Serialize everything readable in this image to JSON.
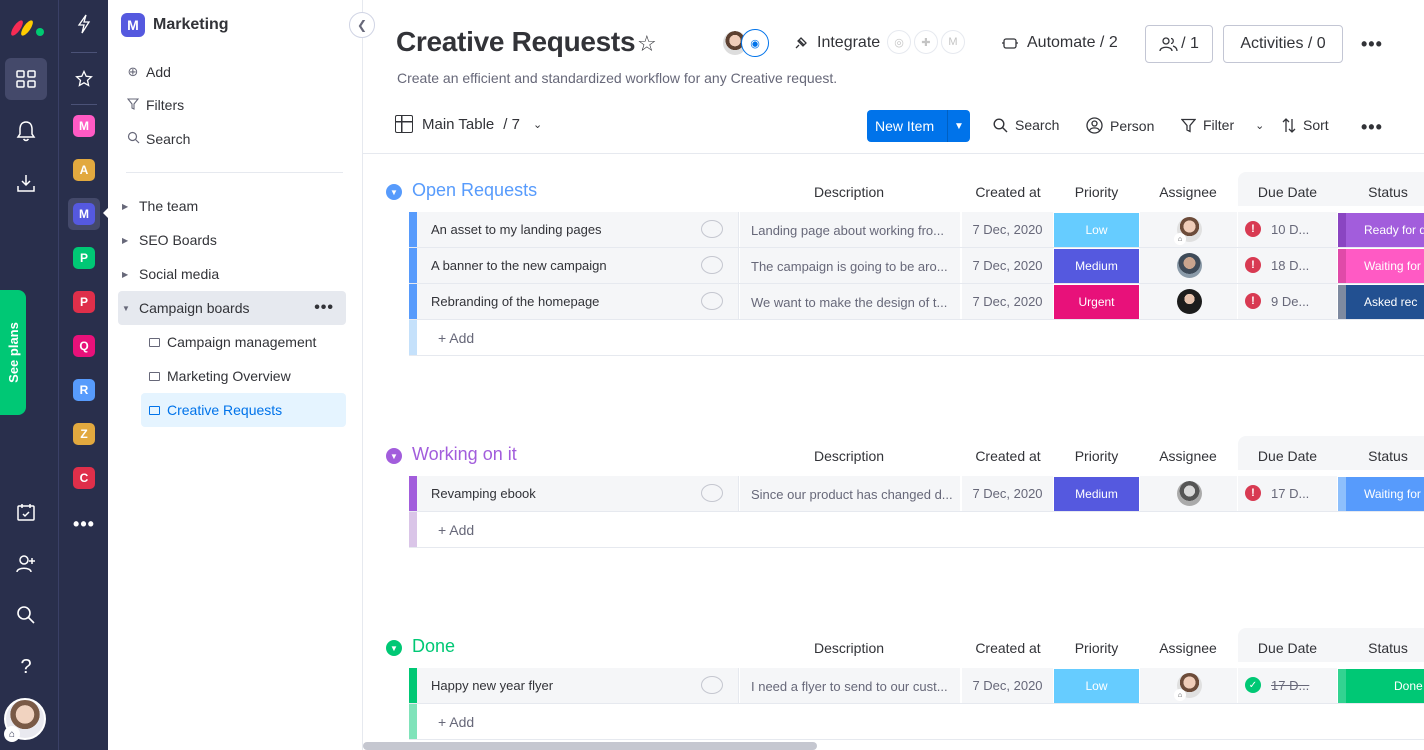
{
  "rail": {
    "see_plans": "See plans"
  },
  "workspaces": [
    {
      "letter": "M",
      "color": "#e2445c",
      "tint": "#ff7eb3"
    },
    {
      "letter": "A",
      "color": "#e2a93f"
    },
    {
      "letter": "M",
      "color": "#5559df"
    },
    {
      "letter": "P",
      "color": "#00c875"
    },
    {
      "letter": "P",
      "color": "#df2f4a"
    },
    {
      "letter": "Q",
      "color": "#e2445c"
    },
    {
      "letter": "R",
      "color": "#579bfc"
    },
    {
      "letter": "Z",
      "color": "#e2a93f"
    },
    {
      "letter": "C",
      "color": "#df2f4a"
    }
  ],
  "sidebar": {
    "workspace_letter": "M",
    "workspace_name": "Marketing",
    "actions": {
      "add": "Add",
      "filters": "Filters",
      "search": "Search"
    },
    "folders": [
      {
        "label": "The team"
      },
      {
        "label": "SEO Boards"
      },
      {
        "label": "Social media"
      },
      {
        "label": "Campaign boards"
      }
    ],
    "boards": [
      {
        "label": "Campaign management"
      },
      {
        "label": "Marketing Overview"
      },
      {
        "label": "Creative Requests"
      }
    ]
  },
  "header": {
    "title": "Creative Requests",
    "description": "Create an efficient and standardized workflow for any Creative request.",
    "integrate": "Integrate",
    "automate": "Automate / 2",
    "members": "/ 1",
    "activities": "Activities / 0"
  },
  "toolbar": {
    "view": "Main Table",
    "view_count": "/ 7",
    "new_item": "New Item",
    "search": "Search",
    "person": "Person",
    "filter": "Filter",
    "sort": "Sort"
  },
  "columns": {
    "description": "Description",
    "created": "Created at",
    "priority": "Priority",
    "assignee": "Assignee",
    "due": "Due Date",
    "status": "Status"
  },
  "colors": {
    "open": "#579bfc",
    "working": "#a25ddc",
    "done": "#00c875",
    "low": "#66ccff",
    "medium": "#5559df",
    "urgent": "#e8117a"
  },
  "groups": [
    {
      "title": "Open Requests",
      "add": "+ Add",
      "rows": [
        {
          "name": "An asset to my landing pages",
          "desc": "Landing page about working fro...",
          "created": "7 Dec, 2020",
          "priority": "Low",
          "due": "10 D...",
          "status": "Ready for d",
          "status_color": "#a25ddc"
        },
        {
          "name": "A banner to the new campaign",
          "desc": "The campaign is going to be aro...",
          "created": "7 Dec, 2020",
          "priority": "Medium",
          "due": "18 D...",
          "status": "Waiting for",
          "status_color": "#ff5ac4"
        },
        {
          "name": "Rebranding of the homepage",
          "desc": "We want to make the design of t...",
          "created": "7 Dec, 2020",
          "priority": "Urgent",
          "due": "9 De...",
          "status": "Asked rec",
          "status_color": "#225091"
        }
      ]
    },
    {
      "title": "Working on it",
      "add": "+ Add",
      "rows": [
        {
          "name": "Revamping ebook",
          "desc": "Since our product has changed d...",
          "created": "7 Dec, 2020",
          "priority": "Medium",
          "due": "17 D...",
          "status": "Waiting for",
          "status_color": "#579bfc"
        }
      ]
    },
    {
      "title": "Done",
      "add": "+ Add",
      "rows": [
        {
          "name": "Happy new year flyer",
          "desc": "I need a flyer to send to our cust...",
          "created": "7 Dec, 2020",
          "priority": "Low",
          "due": "17 D...",
          "status": "Done",
          "status_color": "#00c875"
        }
      ]
    }
  ]
}
